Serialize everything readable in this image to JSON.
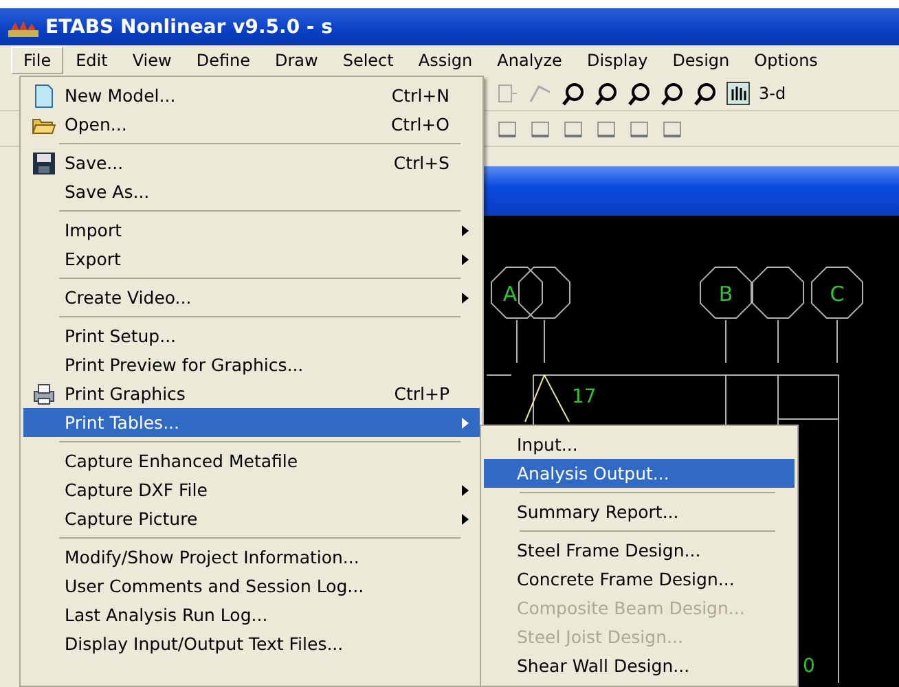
{
  "window": {
    "title": "ETABS Nonlinear v9.5.0 - s"
  },
  "menu_bar": [
    {
      "label": "File",
      "selected": true
    },
    {
      "label": "Edit",
      "selected": false
    },
    {
      "label": "View",
      "selected": false
    },
    {
      "label": "Define",
      "selected": false
    },
    {
      "label": "Draw",
      "selected": false
    },
    {
      "label": "Select",
      "selected": false
    },
    {
      "label": "Assign",
      "selected": false
    },
    {
      "label": "Analyze",
      "selected": false
    },
    {
      "label": "Display",
      "selected": false
    },
    {
      "label": "Design",
      "selected": false
    },
    {
      "label": "Options",
      "selected": false
    }
  ],
  "toolbar": {
    "view_label": "3-d"
  },
  "canvas": {
    "grid_labels": [
      "A",
      "B",
      "C"
    ],
    "point_labels": [
      "17",
      "0"
    ]
  },
  "file_menu": [
    {
      "kind": "icon_item",
      "label": "New Model...",
      "shortcut": "Ctrl+N",
      "selected": false
    },
    {
      "kind": "icon_item",
      "label": "Open...",
      "shortcut": "Ctrl+O",
      "selected": false
    },
    {
      "kind": "separator"
    },
    {
      "kind": "icon_item",
      "label": "Save...",
      "shortcut": "Ctrl+S",
      "selected": false
    },
    {
      "kind": "item",
      "label": "Save As...",
      "selected": false
    },
    {
      "kind": "separator"
    },
    {
      "kind": "item",
      "label": "Import",
      "submenu": true,
      "selected": false
    },
    {
      "kind": "item",
      "label": "Export",
      "submenu": true,
      "selected": false
    },
    {
      "kind": "separator"
    },
    {
      "kind": "item",
      "label": "Create Video...",
      "submenu": true,
      "selected": false
    },
    {
      "kind": "separator"
    },
    {
      "kind": "item",
      "label": "Print Setup...",
      "selected": false
    },
    {
      "kind": "item",
      "label": "Print Preview for Graphics...",
      "selected": false
    },
    {
      "kind": "icon_item",
      "label": "Print Graphics",
      "shortcut": "Ctrl+P",
      "selected": false
    },
    {
      "kind": "item",
      "label": "Print Tables...",
      "submenu": true,
      "selected": true
    },
    {
      "kind": "separator"
    },
    {
      "kind": "item",
      "label": "Capture Enhanced Metafile",
      "selected": false
    },
    {
      "kind": "item",
      "label": "Capture DXF File",
      "submenu": true,
      "selected": false
    },
    {
      "kind": "item",
      "label": "Capture Picture",
      "submenu": true,
      "selected": false
    },
    {
      "kind": "separator"
    },
    {
      "kind": "item",
      "label": "Modify/Show Project Information...",
      "selected": false
    },
    {
      "kind": "item",
      "label": "User Comments and Session Log...",
      "selected": false
    },
    {
      "kind": "item",
      "label": "Last Analysis Run Log...",
      "selected": false
    },
    {
      "kind": "item",
      "label": "Display Input/Output Text Files...",
      "selected": false
    }
  ],
  "print_tables_submenu": [
    {
      "kind": "item",
      "label": "Input...",
      "selected": false,
      "disabled": false
    },
    {
      "kind": "item",
      "label": "Analysis Output...",
      "selected": true,
      "disabled": false
    },
    {
      "kind": "separator"
    },
    {
      "kind": "item",
      "label": "Summary Report...",
      "selected": false,
      "disabled": false
    },
    {
      "kind": "separator"
    },
    {
      "kind": "item",
      "label": "Steel Frame Design...",
      "selected": false,
      "disabled": false
    },
    {
      "kind": "item",
      "label": "Concrete Frame Design...",
      "selected": false,
      "disabled": false
    },
    {
      "kind": "item",
      "label": "Composite Beam Design...",
      "selected": false,
      "disabled": true
    },
    {
      "kind": "item",
      "label": "Steel Joist Design...",
      "selected": false,
      "disabled": true
    },
    {
      "kind": "item",
      "label": "Shear Wall Design...",
      "selected": false,
      "disabled": false
    }
  ]
}
